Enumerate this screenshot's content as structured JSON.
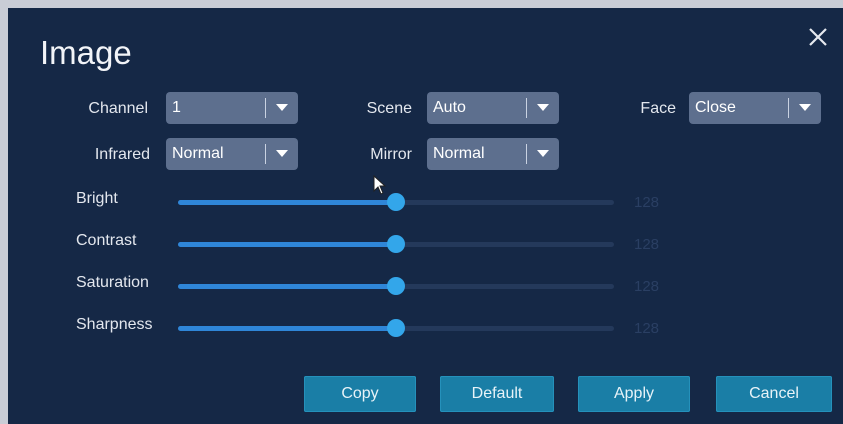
{
  "dialog": {
    "title": "Image",
    "close_icon": "close-icon"
  },
  "fields": {
    "channel": {
      "label": "Channel",
      "value": "1"
    },
    "scene": {
      "label": "Scene",
      "value": "Auto"
    },
    "face": {
      "label": "Face",
      "value": "Close"
    },
    "infrared": {
      "label": "Infrared",
      "value": "Normal"
    },
    "mirror": {
      "label": "Mirror",
      "value": "Normal"
    }
  },
  "sliders": [
    {
      "label": "Bright",
      "value": "128",
      "level": 0.5
    },
    {
      "label": "Contrast",
      "value": "128",
      "level": 0.5
    },
    {
      "label": "Saturation",
      "value": "128",
      "level": 0.5
    },
    {
      "label": "Sharpness",
      "value": "128",
      "level": 0.5
    }
  ],
  "buttons": {
    "copy": "Copy",
    "default": "Default",
    "apply": "Apply",
    "cancel": "Cancel"
  },
  "colors": {
    "background": "#152846",
    "select": "#5d6f8e",
    "slider_fill": "#2f86d8",
    "knob": "#33a6ea",
    "button": "#1a7ea6"
  }
}
